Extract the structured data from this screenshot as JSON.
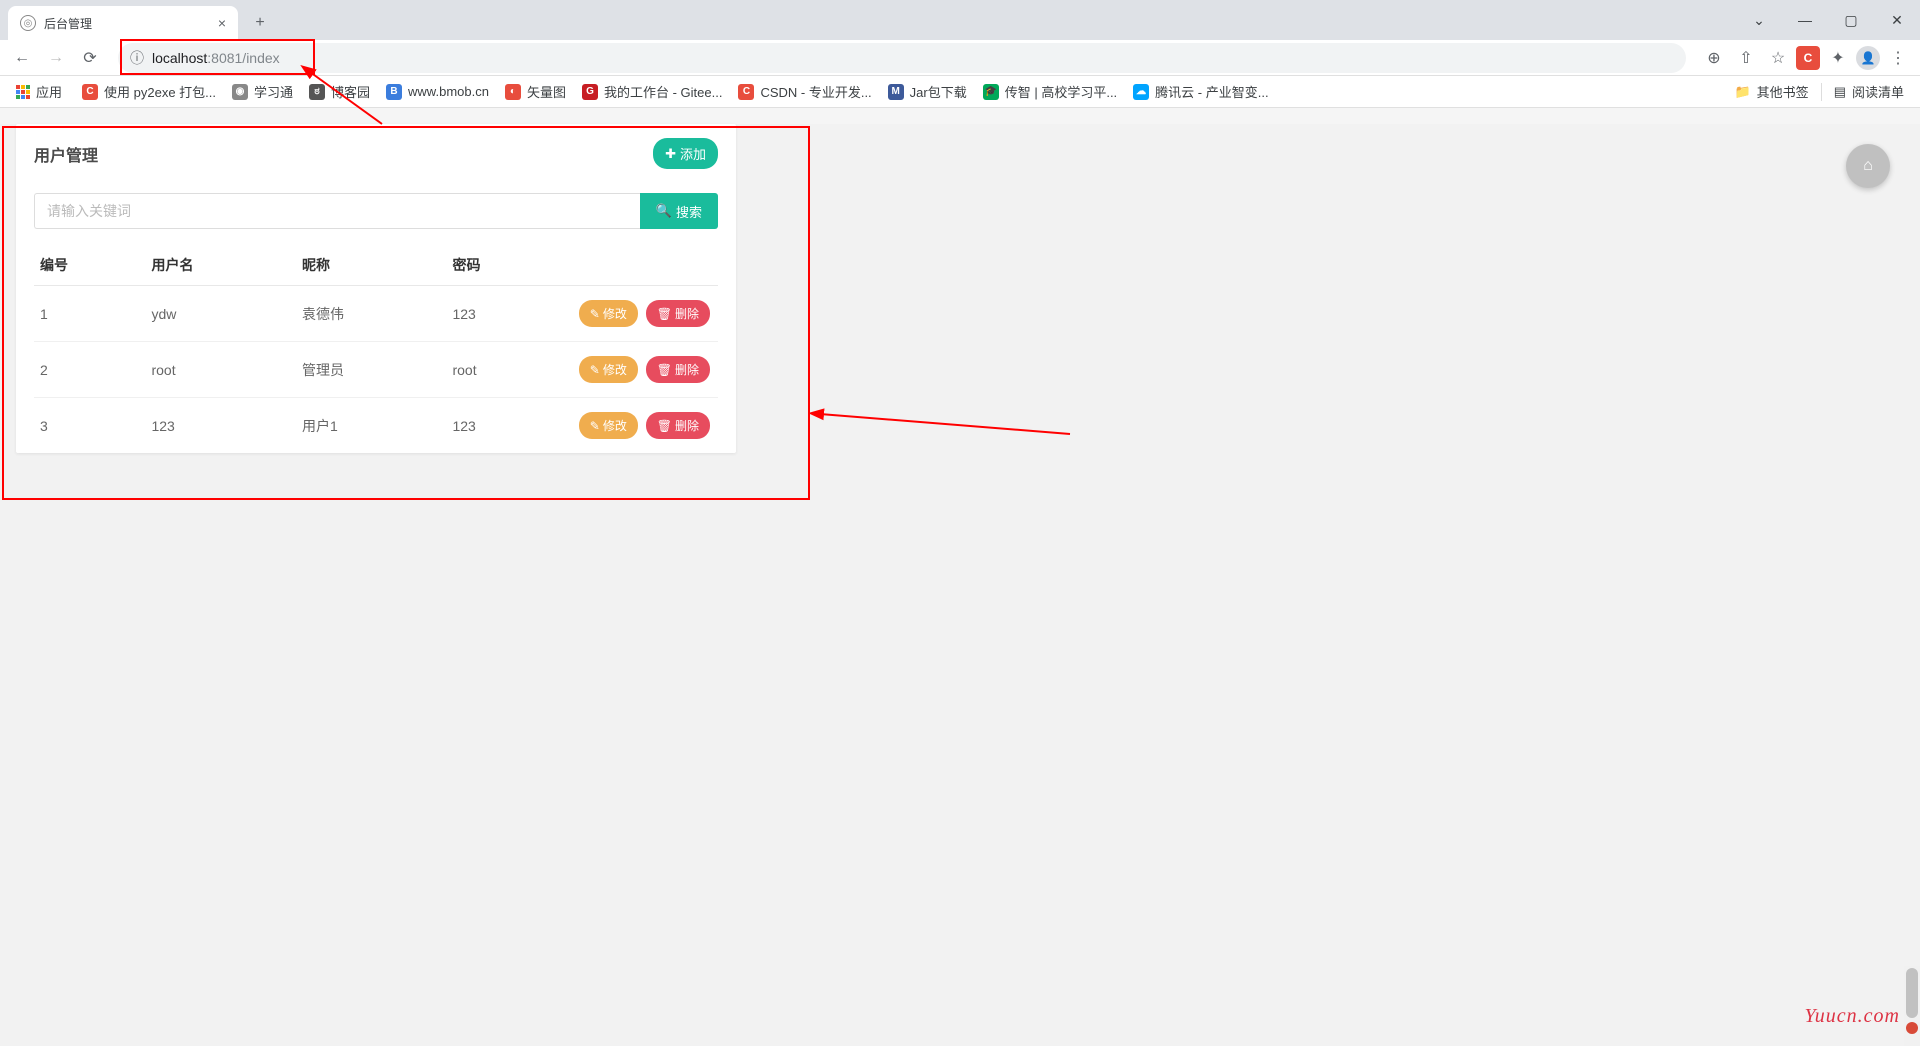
{
  "browser": {
    "tab_title": "后台管理",
    "url_host": "localhost",
    "url_port_path": ":8081/index",
    "apps_label": "应用",
    "bookmarks": [
      {
        "label": "使用 py2exe 打包...",
        "color": "#e84d3d",
        "initial": "C"
      },
      {
        "label": "学习通",
        "color": "#888",
        "initial": "◉"
      },
      {
        "label": "博客园",
        "color": "#555",
        "initial": "ಠ"
      },
      {
        "label": "www.bmob.cn",
        "color": "#3b7ddd",
        "initial": "B"
      },
      {
        "label": "矢量图",
        "color": "#e84d3d",
        "initial": "◐"
      },
      {
        "label": "我的工作台 - Gitee...",
        "color": "#c71d23",
        "initial": "G"
      },
      {
        "label": "CSDN - 专业开发...",
        "color": "#e84d3d",
        "initial": "C"
      },
      {
        "label": "Jar包下载",
        "color": "#3d5a9a",
        "initial": "M"
      },
      {
        "label": "传智 | 高校学习平...",
        "color": "#00a859",
        "initial": "🎓"
      },
      {
        "label": "腾讯云 - 产业智变...",
        "color": "#00a4ff",
        "initial": "☁"
      }
    ],
    "other_bookmarks": "其他书签",
    "reading_list": "阅读清单"
  },
  "panel": {
    "title": "用户管理",
    "add_label": "添加",
    "search_placeholder": "请输入关键词",
    "search_label": "搜索",
    "columns": [
      "编号",
      "用户名",
      "昵称",
      "密码"
    ],
    "edit_label": "修改",
    "delete_label": "删除",
    "rows": [
      {
        "id": "1",
        "username": "ydw",
        "nickname": "袁德伟",
        "password": "123"
      },
      {
        "id": "2",
        "username": "root",
        "nickname": "管理员",
        "password": "root"
      },
      {
        "id": "3",
        "username": "123",
        "nickname": "用户1",
        "password": "123"
      }
    ]
  },
  "watermark": "Yuucn.com"
}
